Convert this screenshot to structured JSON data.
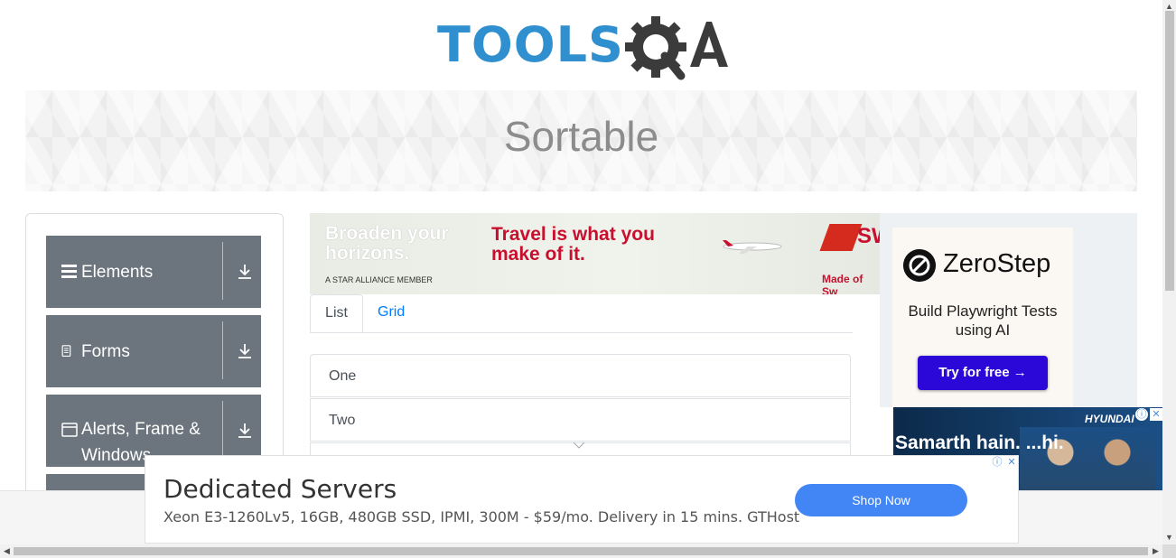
{
  "header": {
    "logo_tools": "TOOLS",
    "logo_qa": "QA"
  },
  "banner": {
    "title": "Sortable"
  },
  "sidebar": {
    "groups": [
      {
        "label": "Elements",
        "icon": "hamburger-icon"
      },
      {
        "label": "Forms",
        "icon": "document-icon"
      },
      {
        "label": "Alerts, Frame & Windows",
        "icon": "window-icon"
      }
    ]
  },
  "ad_top": {
    "headline": "Broaden your horizons.",
    "tagline": "Travel is what you make of it.",
    "member": "A STAR ALLIANCE MEMBER",
    "brand_partial": "SW",
    "made_of": "Made of Sw"
  },
  "tabs": [
    {
      "label": "List",
      "active": true
    },
    {
      "label": "Grid",
      "active": false
    }
  ],
  "list_items": [
    "One",
    "Two"
  ],
  "ad_right": {
    "brand": "ZeroStep",
    "text": "Build Playwright Tests using AI",
    "button": "Try for free →"
  },
  "ad_hyundai": {
    "logo": "HYUNDAI",
    "text": "Samarth hain. ...hi."
  },
  "bottom_ad": {
    "title": "Dedicated Servers",
    "description": "Xeon E3-1260Lv5, 16GB, 480GB SSD, IPMI, 300M - $59/mo. Delivery in 15 mins. GTHost",
    "button": "Shop Now"
  },
  "colors": {
    "logo_blue": "#2f8fcf",
    "sidebar_gray": "#6c757d",
    "link_blue": "#007bff",
    "cta_blue": "#4285f4",
    "zerostep_purple": "#2c08d8"
  }
}
